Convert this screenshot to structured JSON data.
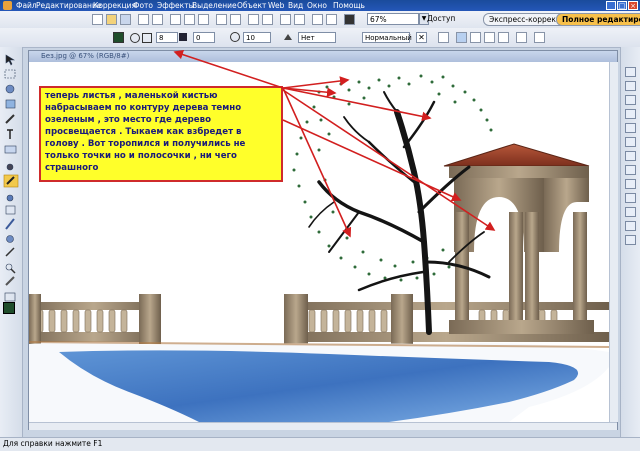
{
  "menu": {
    "items": [
      "Файл",
      "Редактирование",
      "Коррекция",
      "Фото",
      "Эффекты",
      "Выделение",
      "Объект",
      "Web",
      "Вид",
      "Окно",
      "Помощь"
    ]
  },
  "toolbar": {
    "zoom": "67%",
    "access_label": "Доступ",
    "tab_express": "Экспресс-коррекция",
    "tab_full": "Полное редактиров...",
    "brush_size_1": "8",
    "brush_size_2": "0",
    "brush_size_3": "10",
    "texture_value": "Нет",
    "blend_mode": "Нормальный"
  },
  "document": {
    "title": "Без.jpg @ 67% (RGB/8#)"
  },
  "callout": {
    "text": "теперь листья , маленькой кистью набрасываем по контуру дерева темно озеленым , это место где дерево просвещается . Тыкаем как взбредет в голову . Вот торопился и получились не только точки но и полосочки , ни чего страшного"
  },
  "status": {
    "text": "Для справки нажмите F1"
  },
  "colors": {
    "accent": "#2457b8",
    "callout_bg": "#ffff2a",
    "arrow": "#d21f1f",
    "foreground_swatch": "#1f4d2b"
  }
}
